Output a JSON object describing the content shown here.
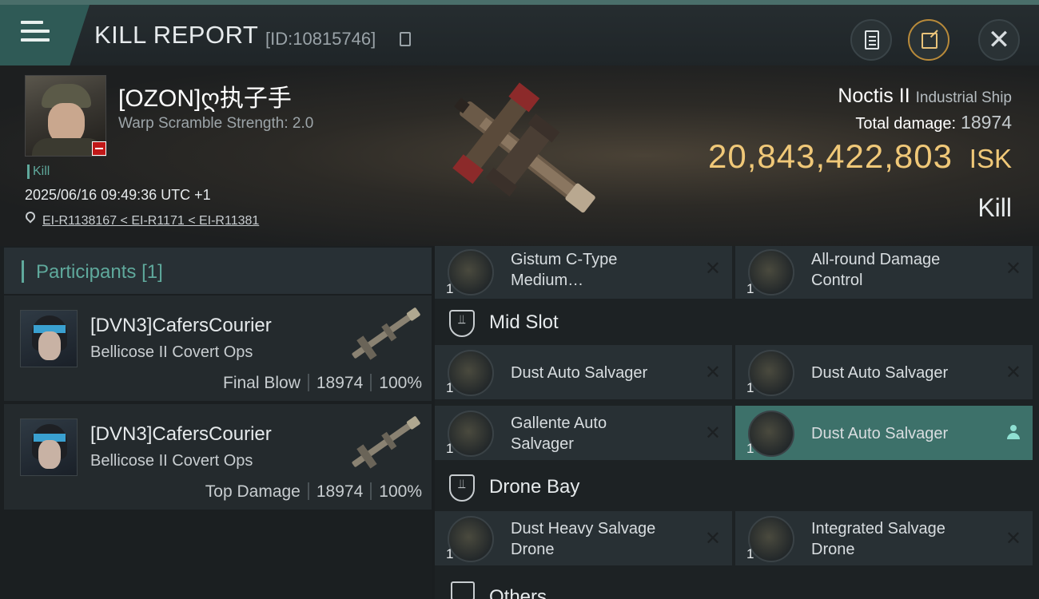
{
  "header": {
    "title": "KILL REPORT",
    "report_id": "[ID:10815746]"
  },
  "victim": {
    "name": "[OZON]ღ执子手",
    "warp_scramble": "Warp Scramble Strength: 2.0",
    "tag": "Kill",
    "datetime": "2025/06/16 09:49:36 UTC +1",
    "location": "EI-R1138167 < EI-R1171 < EI-R11381",
    "ship_name": "Noctis II",
    "ship_class": "Industrial Ship",
    "total_damage_label": "Total damage:",
    "total_damage_value": "18974",
    "isk_value": "20,843,422,803",
    "isk_unit": "ISK",
    "result": "Kill"
  },
  "participants": {
    "header_label": "Participants",
    "count": "[1]",
    "rows": [
      {
        "name": "[DVN3]CafersCourier",
        "ship": "Bellicose II Covert Ops",
        "role": "Final Blow",
        "damage": "18974",
        "percent": "100%"
      },
      {
        "name": "[DVN3]CafersCourier",
        "ship": "Bellicose II Covert Ops",
        "role": "Top Damage",
        "damage": "18974",
        "percent": "100%"
      }
    ]
  },
  "fitting": {
    "low_slots": [
      {
        "qty": "1",
        "name": "Gistum C-Type Medium…",
        "state": "destroyed"
      },
      {
        "qty": "1",
        "name": "All-round Damage Control",
        "state": "destroyed"
      }
    ],
    "mid_slot_label": "Mid Slot",
    "mid_slots": [
      {
        "qty": "1",
        "name": "Dust Auto Salvager",
        "state": "destroyed"
      },
      {
        "qty": "1",
        "name": "Dust Auto Salvager",
        "state": "destroyed"
      },
      {
        "qty": "1",
        "name": "Gallente Auto Salvager",
        "state": "destroyed"
      },
      {
        "qty": "1",
        "name": "Dust Auto Salvager",
        "state": "dropped"
      }
    ],
    "drone_bay_label": "Drone Bay",
    "drone_bay": [
      {
        "qty": "1",
        "name": "Dust Heavy Salvage Drone",
        "state": "destroyed"
      },
      {
        "qty": "1",
        "name": "Integrated Salvage Drone",
        "state": "destroyed"
      }
    ],
    "others_label": "Others",
    "destroyed_mark": "✕"
  },
  "colors": {
    "accent_teal": "#5fa99c",
    "isk_gold": "#f0c878",
    "highlight_row": "#3d716a"
  }
}
